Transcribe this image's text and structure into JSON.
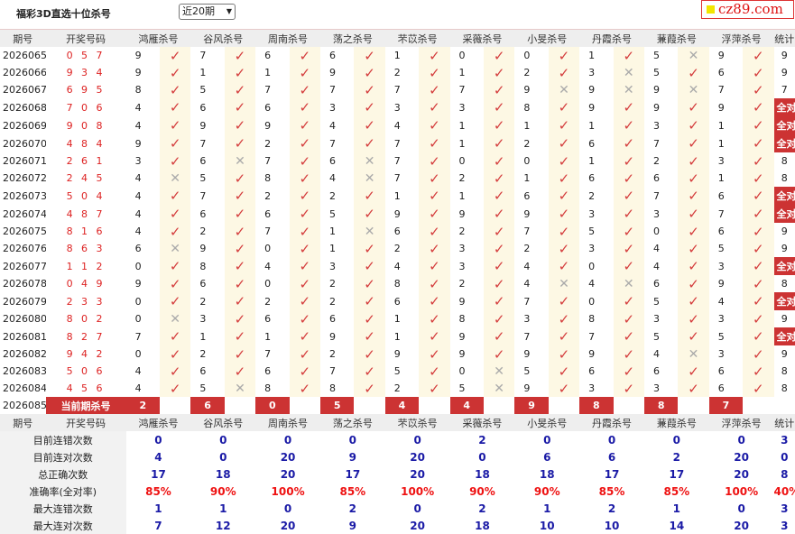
{
  "header": {
    "title": "福彩3D直选十位杀号",
    "period_select": "近20期",
    "logo_text": "cz89.com"
  },
  "columns": [
    "期号",
    "开奖号码",
    "鸿雁杀号",
    "谷风杀号",
    "周南杀号",
    "荡之杀号",
    "芣苡杀号",
    "采薇杀号",
    "小旻杀号",
    "丹霞杀号",
    "蒹葭杀号",
    "浮萍杀号",
    "统计"
  ],
  "rows": [
    {
      "period": "2026065",
      "draw": "0 5 7",
      "k": [
        "9",
        "7",
        "6",
        "6",
        "1",
        "0",
        "0",
        "1",
        "5",
        "9"
      ],
      "m": [
        1,
        1,
        1,
        1,
        1,
        1,
        1,
        1,
        0,
        1
      ],
      "stat": "9"
    },
    {
      "period": "2026066",
      "draw": "9 3 4",
      "k": [
        "9",
        "1",
        "1",
        "9",
        "2",
        "1",
        "2",
        "3",
        "5",
        "6"
      ],
      "m": [
        1,
        1,
        1,
        1,
        1,
        1,
        1,
        0,
        1,
        1
      ],
      "stat": "9"
    },
    {
      "period": "2026067",
      "draw": "6 9 5",
      "k": [
        "8",
        "5",
        "7",
        "7",
        "7",
        "7",
        "9",
        "9",
        "9",
        "7"
      ],
      "m": [
        1,
        1,
        1,
        1,
        1,
        1,
        0,
        0,
        0,
        1
      ],
      "stat": "7"
    },
    {
      "period": "2026068",
      "draw": "7 0 6",
      "k": [
        "4",
        "6",
        "6",
        "3",
        "3",
        "3",
        "8",
        "9",
        "9",
        "9"
      ],
      "m": [
        1,
        1,
        1,
        1,
        1,
        1,
        1,
        1,
        1,
        1
      ],
      "stat": "全对"
    },
    {
      "period": "2026069",
      "draw": "9 0 8",
      "k": [
        "4",
        "9",
        "9",
        "4",
        "4",
        "1",
        "1",
        "1",
        "3",
        "1"
      ],
      "m": [
        1,
        1,
        1,
        1,
        1,
        1,
        1,
        1,
        1,
        1
      ],
      "stat": "全对"
    },
    {
      "period": "2026070",
      "draw": "4 8 4",
      "k": [
        "9",
        "7",
        "2",
        "7",
        "7",
        "1",
        "2",
        "6",
        "7",
        "1"
      ],
      "m": [
        1,
        1,
        1,
        1,
        1,
        1,
        1,
        1,
        1,
        1
      ],
      "stat": "全对"
    },
    {
      "period": "2026071",
      "draw": "2 6 1",
      "k": [
        "3",
        "6",
        "7",
        "6",
        "7",
        "0",
        "0",
        "1",
        "2",
        "3"
      ],
      "m": [
        1,
        0,
        1,
        0,
        1,
        1,
        1,
        1,
        1,
        1
      ],
      "stat": "8"
    },
    {
      "period": "2026072",
      "draw": "2 4 5",
      "k": [
        "4",
        "5",
        "8",
        "4",
        "7",
        "2",
        "1",
        "6",
        "6",
        "1"
      ],
      "m": [
        0,
        1,
        1,
        0,
        1,
        1,
        1,
        1,
        1,
        1
      ],
      "stat": "8"
    },
    {
      "period": "2026073",
      "draw": "5 0 4",
      "k": [
        "4",
        "7",
        "2",
        "2",
        "1",
        "1",
        "6",
        "2",
        "7",
        "6"
      ],
      "m": [
        1,
        1,
        1,
        1,
        1,
        1,
        1,
        1,
        1,
        1
      ],
      "stat": "全对"
    },
    {
      "period": "2026074",
      "draw": "4 8 7",
      "k": [
        "4",
        "6",
        "6",
        "5",
        "9",
        "9",
        "9",
        "3",
        "3",
        "7"
      ],
      "m": [
        1,
        1,
        1,
        1,
        1,
        1,
        1,
        1,
        1,
        1
      ],
      "stat": "全对"
    },
    {
      "period": "2026075",
      "draw": "8 1 6",
      "k": [
        "4",
        "2",
        "7",
        "1",
        "6",
        "2",
        "7",
        "5",
        "0",
        "6"
      ],
      "m": [
        1,
        1,
        1,
        0,
        1,
        1,
        1,
        1,
        1,
        1
      ],
      "stat": "9"
    },
    {
      "period": "2026076",
      "draw": "8 6 3",
      "k": [
        "6",
        "9",
        "0",
        "1",
        "2",
        "3",
        "2",
        "3",
        "4",
        "5"
      ],
      "m": [
        0,
        1,
        1,
        1,
        1,
        1,
        1,
        1,
        1,
        1
      ],
      "stat": "9"
    },
    {
      "period": "2026077",
      "draw": "1 1 2",
      "k": [
        "0",
        "8",
        "4",
        "3",
        "4",
        "3",
        "4",
        "0",
        "4",
        "3"
      ],
      "m": [
        1,
        1,
        1,
        1,
        1,
        1,
        1,
        1,
        1,
        1
      ],
      "stat": "全对"
    },
    {
      "period": "2026078",
      "draw": "0 4 9",
      "k": [
        "9",
        "6",
        "0",
        "2",
        "8",
        "2",
        "4",
        "4",
        "6",
        "9"
      ],
      "m": [
        1,
        1,
        1,
        1,
        1,
        1,
        0,
        0,
        1,
        1
      ],
      "stat": "8"
    },
    {
      "period": "2026079",
      "draw": "2 3 3",
      "k": [
        "0",
        "2",
        "2",
        "2",
        "6",
        "9",
        "7",
        "0",
        "5",
        "4"
      ],
      "m": [
        1,
        1,
        1,
        1,
        1,
        1,
        1,
        1,
        1,
        1
      ],
      "stat": "全对"
    },
    {
      "period": "2026080",
      "draw": "8 0 2",
      "k": [
        "0",
        "3",
        "6",
        "6",
        "1",
        "8",
        "3",
        "8",
        "3",
        "3"
      ],
      "m": [
        0,
        1,
        1,
        1,
        1,
        1,
        1,
        1,
        1,
        1
      ],
      "stat": "9"
    },
    {
      "period": "2026081",
      "draw": "8 2 7",
      "k": [
        "7",
        "1",
        "1",
        "9",
        "1",
        "9",
        "7",
        "7",
        "5",
        "5"
      ],
      "m": [
        1,
        1,
        1,
        1,
        1,
        1,
        1,
        1,
        1,
        1
      ],
      "stat": "全对"
    },
    {
      "period": "2026082",
      "draw": "9 4 2",
      "k": [
        "0",
        "2",
        "7",
        "2",
        "9",
        "9",
        "9",
        "9",
        "4",
        "3"
      ],
      "m": [
        1,
        1,
        1,
        1,
        1,
        1,
        1,
        1,
        0,
        1
      ],
      "stat": "9"
    },
    {
      "period": "2026083",
      "draw": "5 0 6",
      "k": [
        "4",
        "6",
        "6",
        "7",
        "5",
        "0",
        "5",
        "6",
        "6",
        "6"
      ],
      "m": [
        1,
        1,
        1,
        1,
        1,
        0,
        1,
        1,
        1,
        1
      ],
      "stat": "8"
    },
    {
      "period": "2026084",
      "draw": "4 5 6",
      "k": [
        "4",
        "5",
        "8",
        "8",
        "2",
        "5",
        "9",
        "3",
        "3",
        "6"
      ],
      "m": [
        1,
        0,
        1,
        1,
        1,
        0,
        1,
        1,
        1,
        1
      ],
      "stat": "8"
    }
  ],
  "current": {
    "period": "2026085",
    "label": "当前期杀号",
    "values": [
      "2",
      "6",
      "0",
      "5",
      "4",
      "4",
      "9",
      "8",
      "8",
      "7"
    ]
  },
  "summary": [
    {
      "label": "目前连错次数",
      "values": [
        "0",
        "0",
        "0",
        "0",
        "0",
        "2",
        "0",
        "0",
        "0",
        "0"
      ],
      "stat": "3",
      "style": "blue"
    },
    {
      "label": "目前连对次数",
      "values": [
        "4",
        "0",
        "20",
        "9",
        "20",
        "0",
        "6",
        "6",
        "2",
        "20"
      ],
      "stat": "0",
      "style": "blue"
    },
    {
      "label": "总正确次数",
      "values": [
        "17",
        "18",
        "20",
        "17",
        "20",
        "18",
        "18",
        "17",
        "17",
        "20"
      ],
      "stat": "8",
      "style": "blue"
    },
    {
      "label": "准确率(全对率)",
      "values": [
        "85%",
        "90%",
        "100%",
        "85%",
        "100%",
        "90%",
        "90%",
        "85%",
        "85%",
        "100%"
      ],
      "stat": "40%",
      "style": "red"
    },
    {
      "label": "最大连错次数",
      "values": [
        "1",
        "1",
        "0",
        "2",
        "0",
        "2",
        "1",
        "2",
        "1",
        "0"
      ],
      "stat": "3",
      "style": "blue"
    },
    {
      "label": "最大连对次数",
      "values": [
        "7",
        "12",
        "20",
        "9",
        "20",
        "18",
        "10",
        "10",
        "14",
        "20"
      ],
      "stat": "3",
      "style": "blue"
    }
  ],
  "colors": {
    "hit": "#d43c3c",
    "miss": "#aaaaaa",
    "badge": "#cc3333",
    "stat_blue": "#1a1aa6",
    "stat_red": "#e11111",
    "mark_bg": "#fdf8e4"
  },
  "icons": {
    "hit": "check-icon",
    "miss": "cross-icon"
  }
}
